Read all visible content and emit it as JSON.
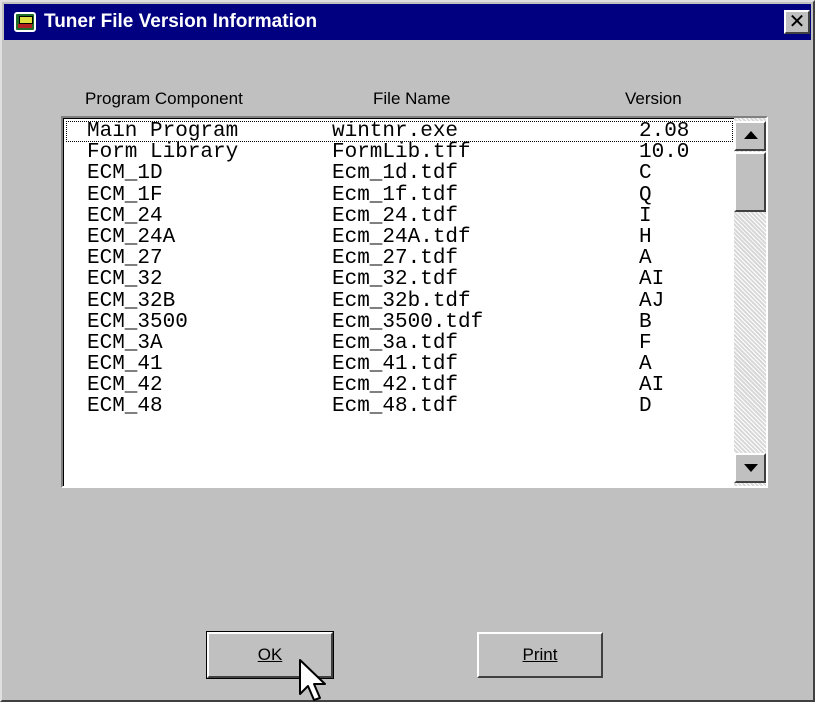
{
  "window": {
    "title": "Tuner File Version Information",
    "close_label": "✕"
  },
  "table": {
    "columns": [
      "Program Component",
      "File Name",
      "Version"
    ],
    "rows": [
      [
        "Main Program",
        "wintnr.exe",
        "2.08"
      ],
      [
        "Form Library",
        "FormLib.tff",
        "10.0"
      ],
      [
        "ECM_1D",
        "Ecm_1d.tdf",
        "C"
      ],
      [
        "ECM_1F",
        "Ecm_1f.tdf",
        "Q"
      ],
      [
        "ECM_24",
        "Ecm_24.tdf",
        "I"
      ],
      [
        "ECM_24A",
        "Ecm_24A.tdf",
        "H"
      ],
      [
        "ECM_27",
        "Ecm_27.tdf",
        "A"
      ],
      [
        "ECM_32",
        "Ecm_32.tdf",
        "AI"
      ],
      [
        "ECM_32B",
        "Ecm_32b.tdf",
        "AJ"
      ],
      [
        "ECM_3500",
        "Ecm_3500.tdf",
        "B"
      ],
      [
        "ECM_3A",
        "Ecm_3a.tdf",
        "F"
      ],
      [
        "ECM_41",
        "Ecm_41.tdf",
        "A"
      ],
      [
        "ECM_42",
        "Ecm_42.tdf",
        "AI"
      ],
      [
        "ECM_48",
        "Ecm_48.tdf",
        "D"
      ]
    ],
    "focused_row": 0
  },
  "buttons": {
    "ok_label": "OK",
    "print_label": "Print"
  },
  "icons": {
    "app": "tuner-app-icon",
    "close": "close-icon",
    "scroll_up": "arrow-up-icon",
    "scroll_down": "arrow-down-icon",
    "cursor": "mouse-cursor-icon"
  },
  "colors": {
    "titlebar": "#000080",
    "face": "#c0c0c0",
    "list_bg": "#ffffff"
  }
}
